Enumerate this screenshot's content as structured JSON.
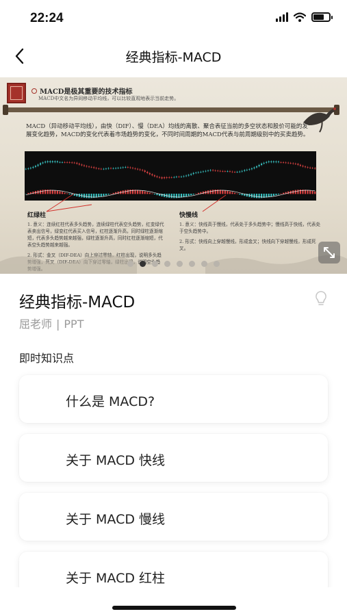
{
  "status_bar": {
    "time": "22:24"
  },
  "nav": {
    "title": "经典指标-MACD"
  },
  "slide": {
    "heading": "MACD是极其重要的技术指标",
    "subheading": "MACD中文名为异同移动平均线，可以比较直观地表示当前走势。",
    "intro": "MACD（异动移动平均线），由快（DIF）、慢（DEA）均线的离散、聚合表征当前的多空状态和股价可能的发展变化趋势，MACD的变化代表着市场趋势的变化，不同时间周期的MACD代表与前周期级别中的买卖趋势。",
    "label_left": "红绿柱",
    "label_right": "快慢线",
    "notes_left": [
      "1. 意义：连续红柱代表多头趋势，连续绿柱代表空头趋势，红变绿代表卖出信号，绿变红代表买入信号，红柱逐渐升高，同时绿柱逐渐缩短，代表多头趋势越来越强，绿柱逐渐升高，同时红柱逐渐缩短，代表空头趋势越来越强。",
      "2. 形式：金叉（DIF-DEA）向上穿过零轴，红柱出现，说明多头趋势增强，死叉（DIF-DEA）向下穿过零轴，绿柱出现，说明空头趋势增强。"
    ],
    "notes_right": [
      "1. 意义：快线高于慢线，代表处于多头趋势中；慢线高于快线，代表处于空头趋势中。",
      "2. 形式：快线向上穿越慢线，形成金叉；快线向下穿越慢线，形成死叉。"
    ],
    "page_count": 8,
    "active_page": 2
  },
  "course": {
    "title": "经典指标-MACD",
    "teacher": "屈老师",
    "separator": "|",
    "type": "PPT"
  },
  "knowledge": {
    "section_title": "即时知识点",
    "items": [
      {
        "label": "什么是 MACD?"
      },
      {
        "label": "关于 MACD 快线"
      },
      {
        "label": "关于 MACD 慢线"
      },
      {
        "label": "关于 MACD 红柱"
      }
    ]
  },
  "icons": {
    "back": "chevron-left-icon",
    "expand": "expand-icon",
    "bulb": "lightbulb-icon",
    "signal": "signal-icon",
    "wifi": "wifi-icon",
    "battery": "battery-icon"
  },
  "colors": {
    "seal_red": "#a5322a",
    "candle_up": "#e04343",
    "candle_down": "#39c3c3",
    "pointer_line": "#d2302a"
  }
}
